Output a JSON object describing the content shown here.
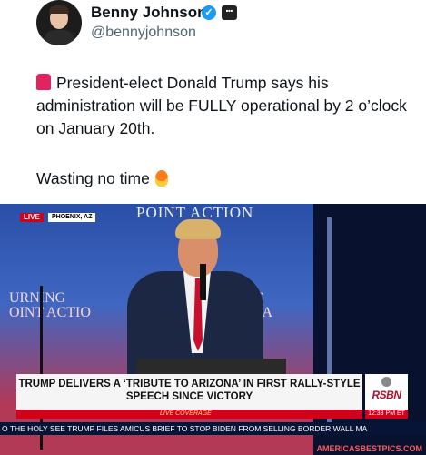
{
  "author": {
    "display_name": "Benny Johnson",
    "verified_icon": "verified-badge-icon",
    "affiliate_badge": "affiliate-badge-icon",
    "handle": "@bennyjohnson"
  },
  "tweet": {
    "siren_icon": "siren-emoji-icon",
    "line1": "President-elect Donald Trump says his administration will be FULLY operational by 2 o’clock on January 20th.",
    "line2": "Wasting no time",
    "fire_icon": "fire-emoji-icon"
  },
  "video": {
    "live_label": "LIVE",
    "location": "PHOENIX, AZ",
    "banner_top": "POINT ACTION",
    "banner_left": "URNING\nOINT ACTIO",
    "banner_right": "NG\nUSA",
    "headline": "TRUMP DELIVERS A ‘TRIBUTE TO ARIZONA’ IN FIRST RALLY-STYLE SPEECH SINCE VICTORY",
    "live_coverage": "LIVE COVERAGE",
    "network": "RSBN",
    "time": "12:33 PM ET",
    "ticker": "O THE HOLY SEE    TRUMP FILES AMICUS BRIEF TO STOP BIDEN FROM SELLING BORDER WALL MA"
  },
  "watermark": "AMERICASBESTPICS.COM",
  "colors": {
    "live_red": "#d0021b",
    "verified_blue": "#1d9bf0",
    "ticker_bg": "#061436"
  }
}
